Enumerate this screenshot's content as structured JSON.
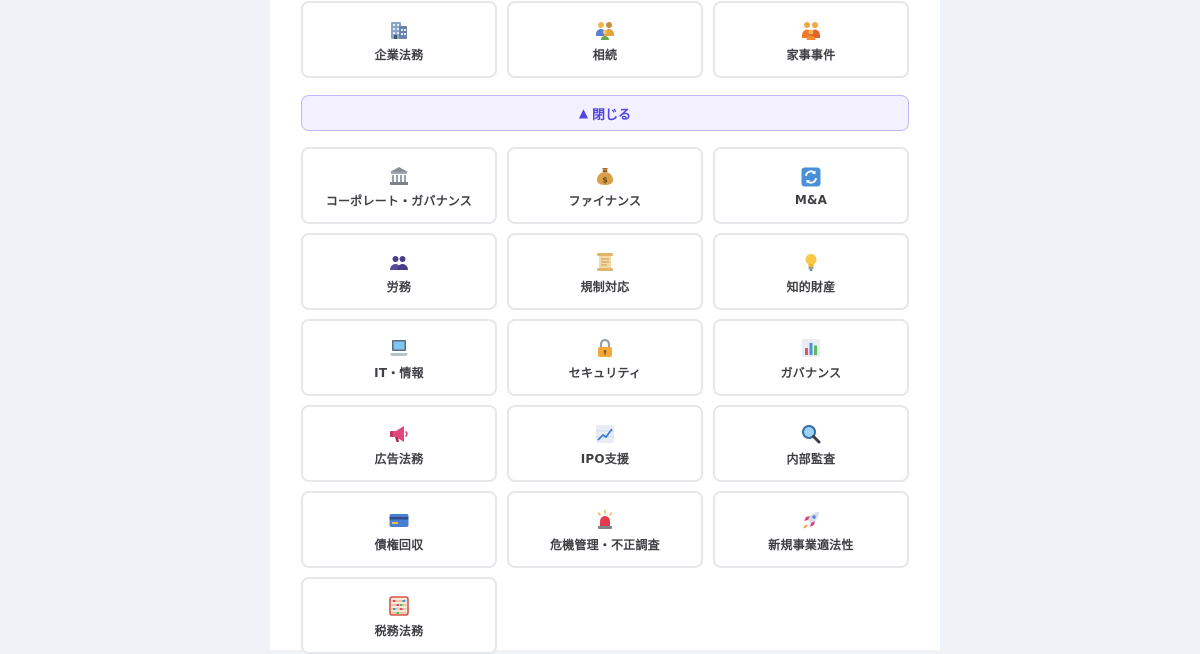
{
  "top_categories": [
    {
      "label": "企業法務",
      "icon": "office-building-icon"
    },
    {
      "label": "相続",
      "icon": "family-icon"
    },
    {
      "label": "家事事件",
      "icon": "family-orange-icon"
    }
  ],
  "toggle": {
    "arrow": "▲",
    "label": "閉じる"
  },
  "categories": [
    {
      "label": "コーポレート・ガバナンス",
      "icon": "classical-building-icon"
    },
    {
      "label": "ファイナンス",
      "icon": "money-bag-icon"
    },
    {
      "label": "M&A",
      "icon": "repeat-arrows-icon"
    },
    {
      "label": "労務",
      "icon": "people-silhouette-icon"
    },
    {
      "label": "規制対応",
      "icon": "scroll-icon"
    },
    {
      "label": "知的財産",
      "icon": "light-bulb-icon"
    },
    {
      "label": "IT・情報",
      "icon": "laptop-icon"
    },
    {
      "label": "セキュリティ",
      "icon": "lock-icon"
    },
    {
      "label": "ガバナンス",
      "icon": "bar-chart-icon"
    },
    {
      "label": "広告法務",
      "icon": "megaphone-icon"
    },
    {
      "label": "IPO支援",
      "icon": "trend-up-chart-icon"
    },
    {
      "label": "内部監査",
      "icon": "magnifying-glass-icon"
    },
    {
      "label": "債権回収",
      "icon": "credit-card-icon"
    },
    {
      "label": "危機管理・不正調査",
      "icon": "siren-icon"
    },
    {
      "label": "新規事業適法性",
      "icon": "rocket-icon"
    },
    {
      "label": "税務法務",
      "icon": "abacus-icon"
    }
  ],
  "colors": {
    "page_background": "#eff3f8",
    "panel_background": "#ffffff",
    "card_border": "#e5e7eb",
    "label_text": "#3f3f46",
    "toggle_background": "#f3f0ff",
    "toggle_border": "#c4b5fd",
    "toggle_text": "#4f46e5"
  }
}
